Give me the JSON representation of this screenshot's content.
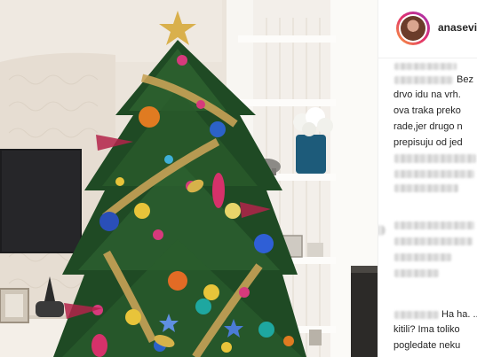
{
  "post": {
    "username": "anasevi"
  },
  "comments": [
    {
      "lines": [
        "Bez",
        "drvo idu na vrh.",
        "ova traka preko",
        "rade,jer drugo n",
        "prepisuju od jed"
      ]
    },
    {
      "lines": [
        "Ha ha. ..",
        "kitili? Ima toliko",
        "pogledate neku"
      ]
    }
  ],
  "colors": {
    "avatar_ring": "#e1306c",
    "username": "#262626",
    "comment_text": "#262626"
  }
}
